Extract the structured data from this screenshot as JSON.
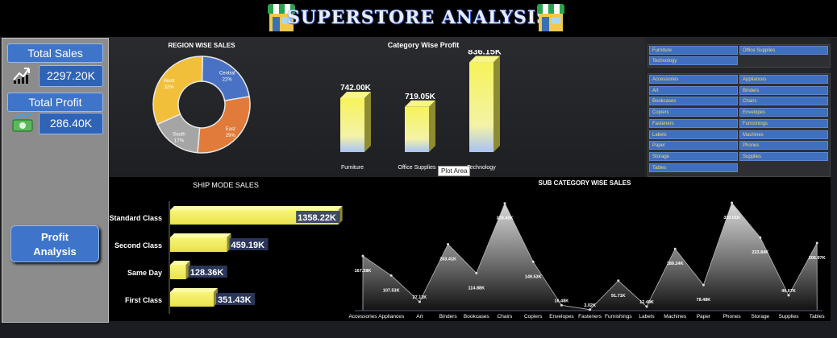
{
  "header": {
    "title": "SUPERSTORE ANALYSIS"
  },
  "kpis": {
    "total_sales_label": "Total Sales",
    "total_sales_value": "2297.20K",
    "total_profit_label": "Total Profit",
    "total_profit_value": "286.40K"
  },
  "nav": {
    "profit_analysis_label": "Profit\nAnalysis"
  },
  "tooltip": "Plot Area",
  "category_slicer": [
    "Furniture",
    "Office Supplies",
    "Technology"
  ],
  "subcategory_slicer": [
    "Accessories",
    "Appliances",
    "Art",
    "Binders",
    "Bookcases",
    "Chairs",
    "Copiers",
    "Envelopes",
    "Fasteners",
    "Furnishings",
    "Labels",
    "Machines",
    "Paper",
    "Phones",
    "Storage",
    "Supplies",
    "Tables"
  ],
  "colors": {
    "accent_blue": "#3e74c9",
    "bar_yellow": "#f4f06a",
    "slicer_text": "#f3d970"
  },
  "chart_data": [
    {
      "type": "pie",
      "title": "REGION WISE SALES",
      "labels": [
        "Central",
        "East",
        "South",
        "West"
      ],
      "values": [
        22,
        29,
        17,
        32
      ],
      "value_labels": [
        "22%",
        "29%",
        "17%",
        "32%"
      ],
      "colors": [
        "#4a72c4",
        "#e07b39",
        "#a5a5a5",
        "#f2bf3a"
      ]
    },
    {
      "type": "bar",
      "title": "Category Wise Profit",
      "categories": [
        "Furniture",
        "Office Supplies",
        "Technology"
      ],
      "values": [
        742.0,
        719.05,
        836.15
      ],
      "value_labels": [
        "742.00K",
        "719.05K",
        "836.15K"
      ],
      "ylim": [
        600,
        850
      ]
    },
    {
      "type": "bar",
      "orientation": "horizontal",
      "title": "SHIP MODE SALES",
      "categories": [
        "Standard Class",
        "Second Class",
        "Same Day",
        "First Class"
      ],
      "values": [
        1358.22,
        459.19,
        128.36,
        351.43
      ],
      "value_labels": [
        "1358.22K",
        "459.19K",
        "128.36K",
        "351.43K"
      ],
      "xlim": [
        0,
        1400
      ]
    },
    {
      "type": "area",
      "title": "SUB CATEGORY WISE SALES",
      "categories": [
        "Accessories",
        "Appliances",
        "Art",
        "Binders",
        "Bookcases",
        "Chairs",
        "Copiers",
        "Envelopes",
        "Fasteners",
        "Furnishings",
        "Labels",
        "Machines",
        "Paper",
        "Phones",
        "Storage",
        "Supplies",
        "Tables"
      ],
      "values": [
        167.38,
        107.53,
        27.12,
        203.41,
        114.88,
        328.45,
        149.53,
        16.48,
        3.02,
        91.71,
        12.49,
        189.24,
        78.48,
        330.01,
        223.84,
        46.67,
        206.97
      ],
      "value_labels": [
        "167.38K",
        "107.53K",
        "27.12K",
        "203.41K",
        "114.88K",
        "328.45K",
        "149.53K",
        "16.48K",
        "3.02K",
        "91.71K",
        "12.49K",
        "189.24K",
        "78.48K",
        "330.01K",
        "223.84K",
        "46.67K",
        "206.97K"
      ],
      "ylim": [
        0,
        340
      ]
    }
  ]
}
